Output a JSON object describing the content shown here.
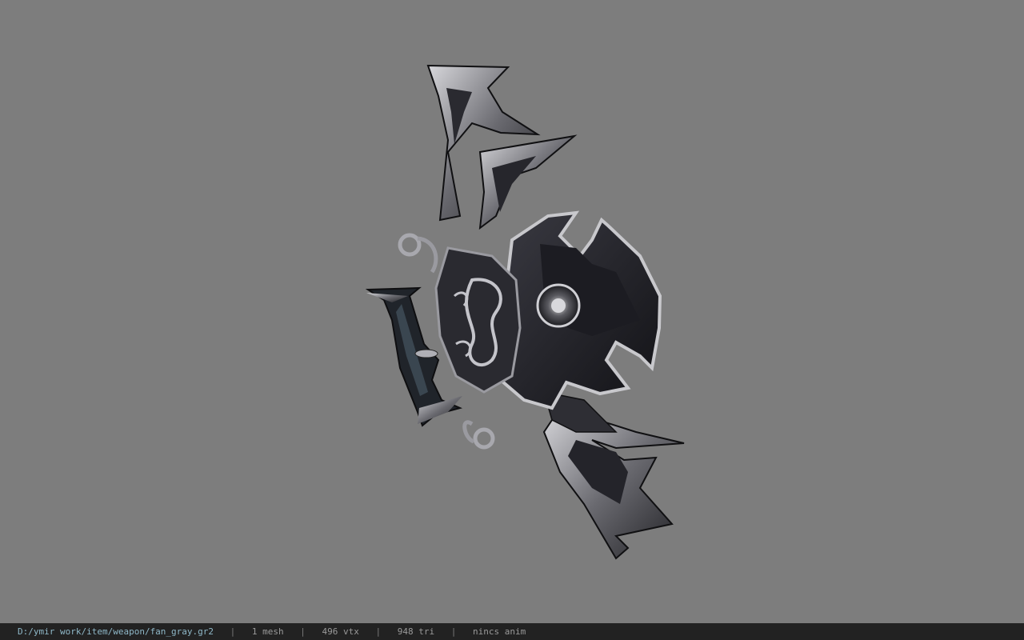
{
  "viewer": {
    "background_color": "#7d7d7d",
    "model_subject": "weapon-fan-model"
  },
  "status": {
    "file_path": "D:/ymir work/item/weapon/fan_gray.gr2",
    "separator": "|",
    "mesh_count": "1 mesh",
    "vertex_count": "496 vtx",
    "triangle_count": "948 tri",
    "anim_info": "nincs anim"
  },
  "colors": {
    "status_bg": "#222222",
    "path_text": "#8fb8c8",
    "status_text": "#9a9a9a"
  }
}
